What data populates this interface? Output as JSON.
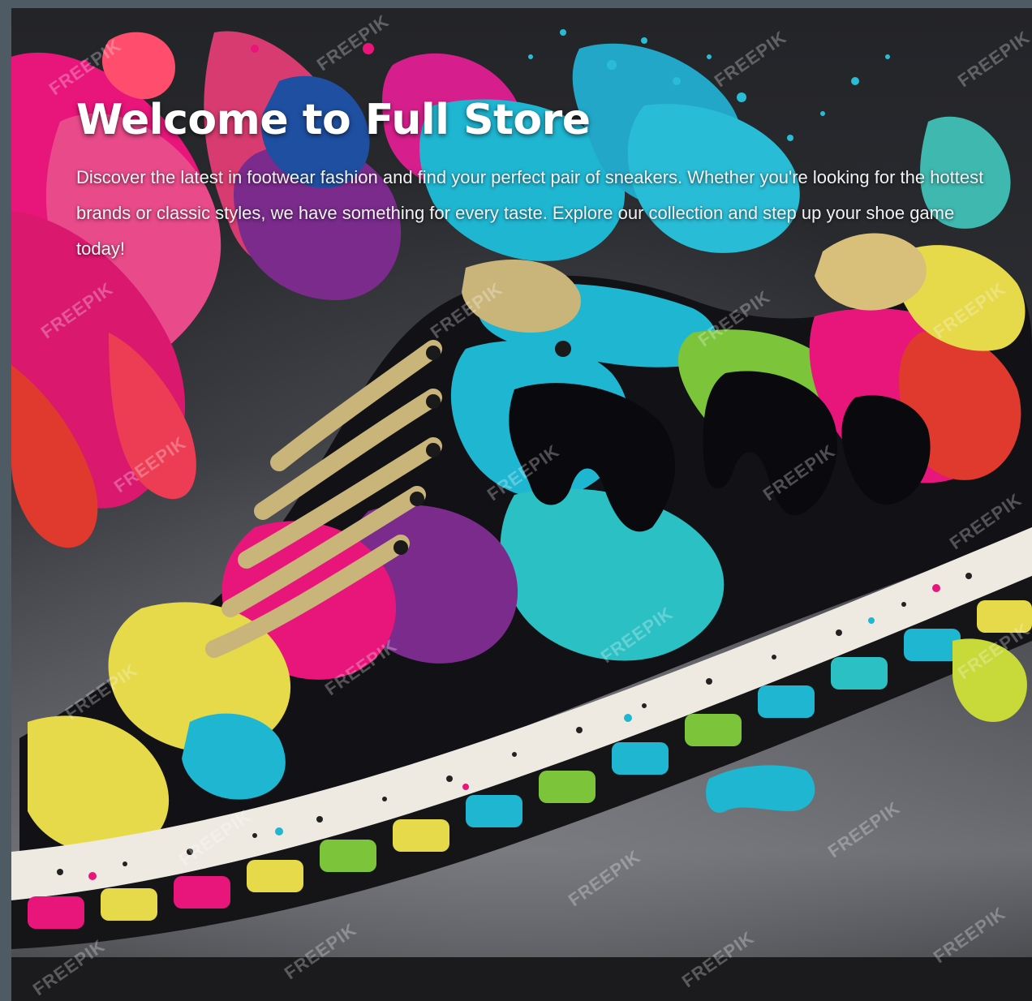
{
  "hero": {
    "title": "Welcome to Full Store",
    "description": "Discover the latest in footwear fashion and find your perfect pair of sneakers. Whether you're looking for the hottest brands or classic styles, we have something for every taste. Explore our collection and step up your shoe game today!",
    "image_alt": "colorful paint splash sneaker"
  },
  "watermark": {
    "text": "FREEPIK"
  },
  "colors": {
    "page_border": "#4e5b64",
    "background": "#2a2b30",
    "title": "#ffffff",
    "pink": "#e8157a",
    "cyan": "#1fb6d2",
    "yellow": "#e6d94a",
    "lime": "#7cc43a",
    "purple": "#7a2b8c",
    "red": "#e03a2f",
    "lace": "#c9b47a"
  }
}
